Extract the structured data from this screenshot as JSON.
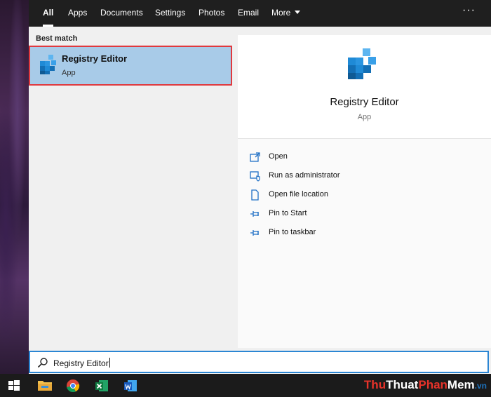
{
  "tabs": [
    {
      "label": "All",
      "active": true
    },
    {
      "label": "Apps"
    },
    {
      "label": "Documents"
    },
    {
      "label": "Settings"
    },
    {
      "label": "Photos"
    },
    {
      "label": "Email"
    },
    {
      "label": "More"
    }
  ],
  "overflow_label": "···",
  "results": {
    "section_label": "Best match",
    "best_match": {
      "title": "Registry Editor",
      "subtitle": "App",
      "icon": "registry-editor-icon"
    }
  },
  "preview": {
    "title": "Registry Editor",
    "subtitle": "App",
    "actions": [
      {
        "label": "Open",
        "icon": "open-window-icon"
      },
      {
        "label": "Run as administrator",
        "icon": "shield-icon"
      },
      {
        "label": "Open file location",
        "icon": "file-location-icon"
      },
      {
        "label": "Pin to Start",
        "icon": "pin-icon"
      },
      {
        "label": "Pin to taskbar",
        "icon": "pin-icon"
      }
    ]
  },
  "search": {
    "value": "Registry Editor",
    "icon": "search-icon"
  },
  "taskbar": {
    "items": [
      "windows-start-icon",
      "file-explorer-icon",
      "chrome-icon",
      "excel-icon",
      "word-icon"
    ]
  },
  "watermark": {
    "part1": "Thu",
    "part2": "Thuat",
    "part3": "Phan",
    "part4": "Mem",
    "part5": ".vn"
  },
  "colors": {
    "accent": "#2b86d3",
    "selection": "#a8cbe8",
    "highlight_border": "#e0393e",
    "topbar": "#1f1f1f"
  }
}
